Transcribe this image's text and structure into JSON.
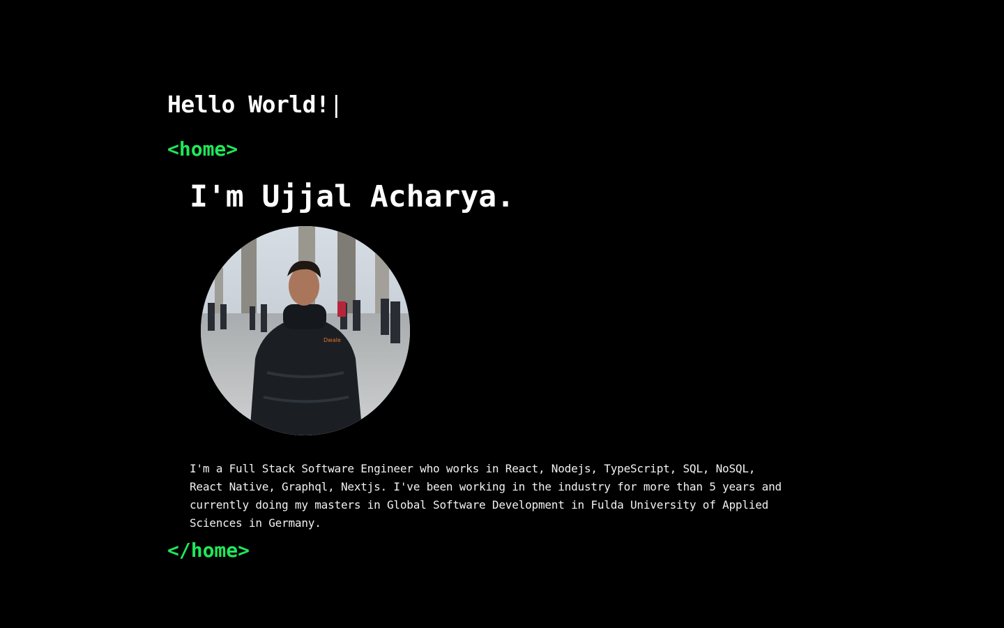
{
  "greeting": {
    "text": "Hello World!",
    "cursor": "|"
  },
  "home": {
    "open_tag": "<home>",
    "close_tag": "</home>",
    "title": "I'm Ujjal Acharya.",
    "bio": "I'm a Full Stack Software Engineer who works in React, Nodejs, TypeScript, SQL, NoSQL, React Native, Graphql, Nextjs. I've been working in the industry for more than 5 years and currently doing my masters in Global Software Development in Fulda University of Applied Sciences in Germany.",
    "photo_logo_text": "Dwale"
  },
  "colors": {
    "background": "#000000",
    "text": "#ffffff",
    "accent": "#1fe85a"
  }
}
